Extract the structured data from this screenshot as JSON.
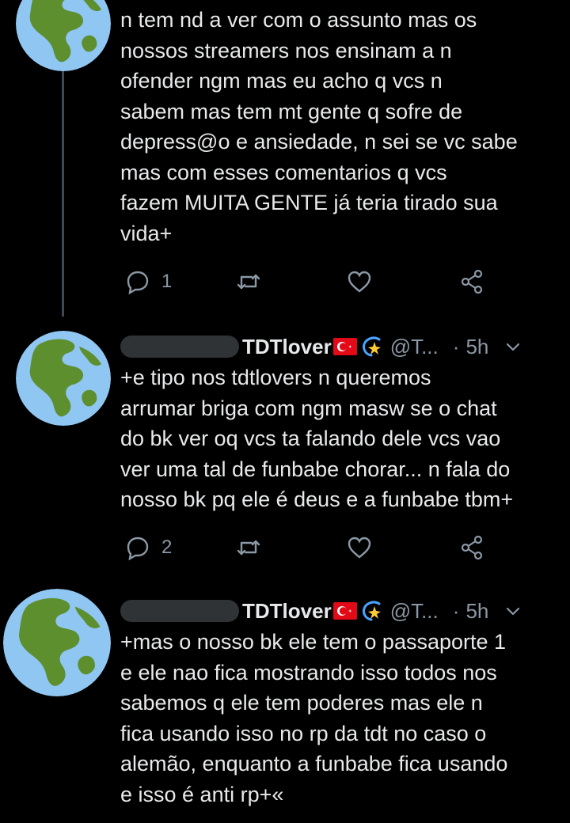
{
  "tweets": [
    {
      "lines": [
        "n tem nd a ver com o assunto mas os",
        "nossos streamers nos ensinam a n",
        "ofender ngm mas eu acho q vcs n",
        "sabem mas tem mt gente q sofre de",
        "depress@o e ansiedade, n sei se vc sabe",
        "mas com esses comentarios q vcs",
        "fazem MUITA GENTE já teria tirado sua",
        "vida+"
      ],
      "reply_count": "1"
    },
    {
      "display_name": "TDTlover",
      "handle": "@T...",
      "dot": "·",
      "time": "5h",
      "lines": [
        "+e tipo nos tdtlovers n queremos",
        "arrumar briga com ngm masw se o chat",
        "do bk ver oq vcs ta falando dele vcs vao",
        "ver uma tal de funbabe chorar... n fala do",
        "nosso bk pq ele é deus e a funbabe tbm+"
      ],
      "reply_count": "2"
    },
    {
      "display_name": "TDTlover",
      "handle": "@T...",
      "dot": "·",
      "time": "5h",
      "lines": [
        "+mas o nosso bk ele tem o passaporte 1",
        "e ele nao fica mostrando isso todos nos",
        "sabemos q ele tem poderes mas ele n",
        "fica usando isso no rp da tdt no caso o",
        "alemão, enquanto a funbabe fica usando",
        "e isso é anti rp+«"
      ]
    }
  ],
  "icons": {
    "avatar": "globe-americas-icon",
    "reply": "reply-icon",
    "retweet": "retweet-icon",
    "like": "heart-icon",
    "share": "share-icon",
    "flag": "turkey-flag-icon",
    "sparkle": "dizzy-sparkle-icon",
    "more": "chevron-down-icon"
  },
  "colors": {
    "background": "#000000",
    "text": "#e7e9ea",
    "secondary": "#8b98a5",
    "thread_line": "#3d4a55"
  }
}
